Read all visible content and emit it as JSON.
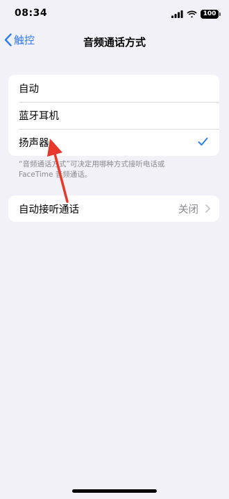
{
  "status_bar": {
    "time": "08:34",
    "battery": "100",
    "icons": [
      "cellular-signal-icon",
      "wifi-icon",
      "battery-icon"
    ]
  },
  "nav": {
    "back_label": "触控",
    "title": "音频通话方式"
  },
  "options": [
    {
      "label": "自动",
      "selected": false
    },
    {
      "label": "蓝牙耳机",
      "selected": false
    },
    {
      "label": "扬声器",
      "selected": true
    }
  ],
  "footer": "“音频通话方式”可决定用哪种方式接听电话或 FaceTime 音频通话。",
  "auto_answer": {
    "label": "自动接听通话",
    "value": "关闭"
  },
  "colors": {
    "accent": "#2f7cf6",
    "background": "#f2f1f7",
    "annotation": "#e8382c"
  }
}
